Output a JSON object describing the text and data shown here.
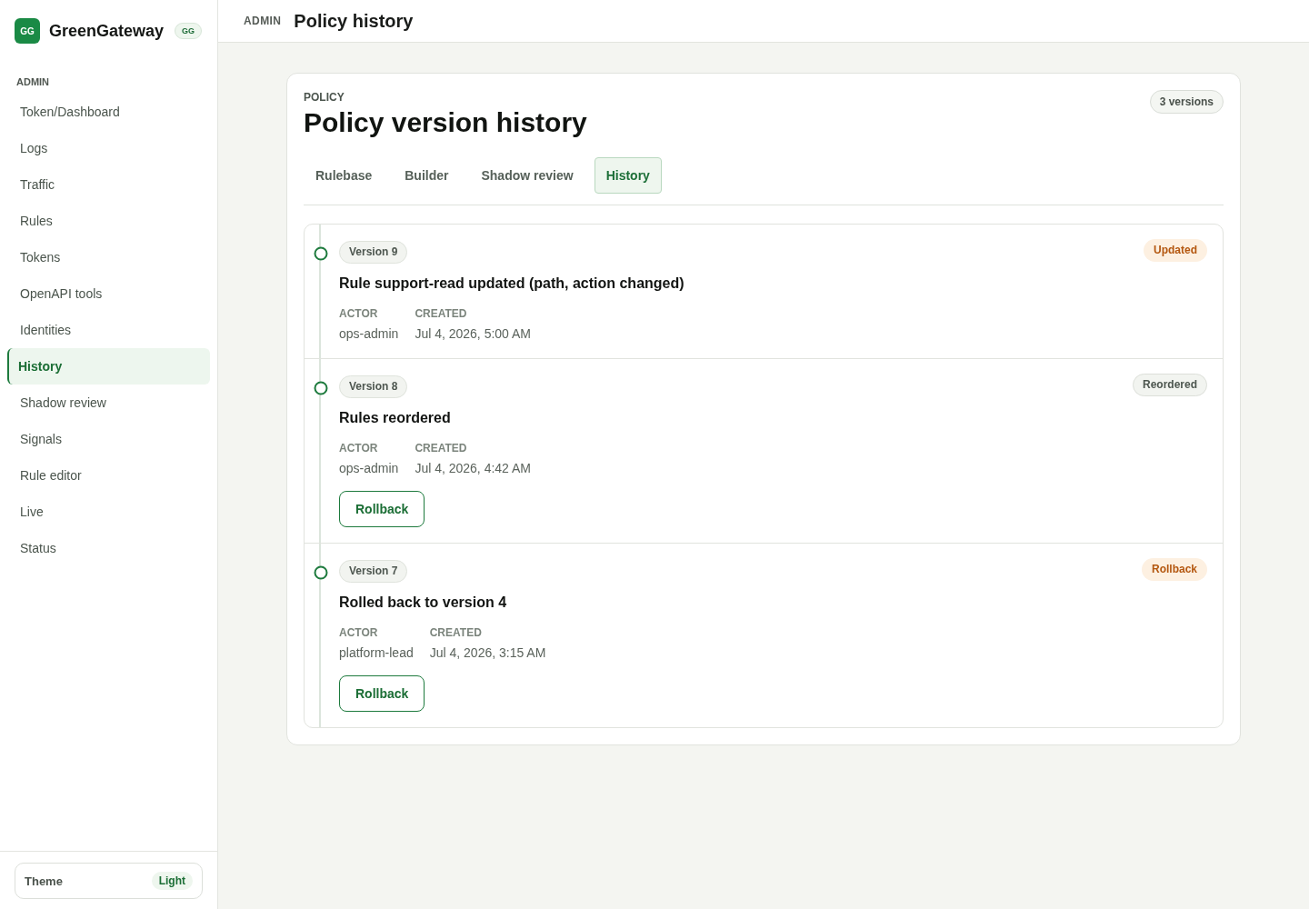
{
  "brand": {
    "logo": "GG",
    "name": "GreenGateway",
    "badge": "GG"
  },
  "sidebar": {
    "section": "ADMIN",
    "items": [
      {
        "label": "Token/Dashboard",
        "selected": false
      },
      {
        "label": "Logs",
        "selected": false
      },
      {
        "label": "Traffic",
        "selected": false
      },
      {
        "label": "Rules",
        "selected": false
      },
      {
        "label": "Tokens",
        "selected": false
      },
      {
        "label": "OpenAPI tools",
        "selected": false
      },
      {
        "label": "Identities",
        "selected": false
      },
      {
        "label": "History",
        "selected": true
      },
      {
        "label": "Shadow review",
        "selected": false
      },
      {
        "label": "Signals",
        "selected": false
      },
      {
        "label": "Rule editor",
        "selected": false
      },
      {
        "label": "Live",
        "selected": false
      },
      {
        "label": "Status",
        "selected": false
      }
    ],
    "theme": {
      "label": "Theme",
      "value": "Light"
    }
  },
  "topbar": {
    "section": "ADMIN",
    "title": "Policy history"
  },
  "card": {
    "eyebrow": "POLICY",
    "title": "Policy version history",
    "count": "3 versions",
    "tabs": [
      {
        "label": "Rulebase",
        "selected": false
      },
      {
        "label": "Builder",
        "selected": false
      },
      {
        "label": "Shadow review",
        "selected": false
      },
      {
        "label": "History",
        "selected": true
      }
    ],
    "versions": [
      {
        "version": "Version 9",
        "tag": {
          "label": "Updated",
          "kind": "update"
        },
        "summary": "Rule support-read updated (path, action changed)",
        "meta": [
          {
            "label": "ACTOR",
            "value": "ops-admin"
          },
          {
            "label": "CREATED",
            "value": "Jul 4, 2026, 5:00 AM"
          }
        ]
      },
      {
        "version": "Version 8",
        "tag": {
          "label": "Reordered",
          "kind": "reorder"
        },
        "summary": "Rules reordered",
        "meta": [
          {
            "label": "ACTOR",
            "value": "ops-admin"
          },
          {
            "label": "CREATED",
            "value": "Jul 4, 2026, 4:42 AM"
          }
        ],
        "action": "Rollback"
      },
      {
        "version": "Version 7",
        "tag": {
          "label": "Rollback",
          "kind": "rollback"
        },
        "summary": "Rolled back to version 4",
        "meta": [
          {
            "label": "ACTOR",
            "value": "platform-lead"
          },
          {
            "label": "CREATED",
            "value": "Jul 4, 2026, 3:15 AM"
          }
        ],
        "action": "Rollback"
      }
    ]
  }
}
